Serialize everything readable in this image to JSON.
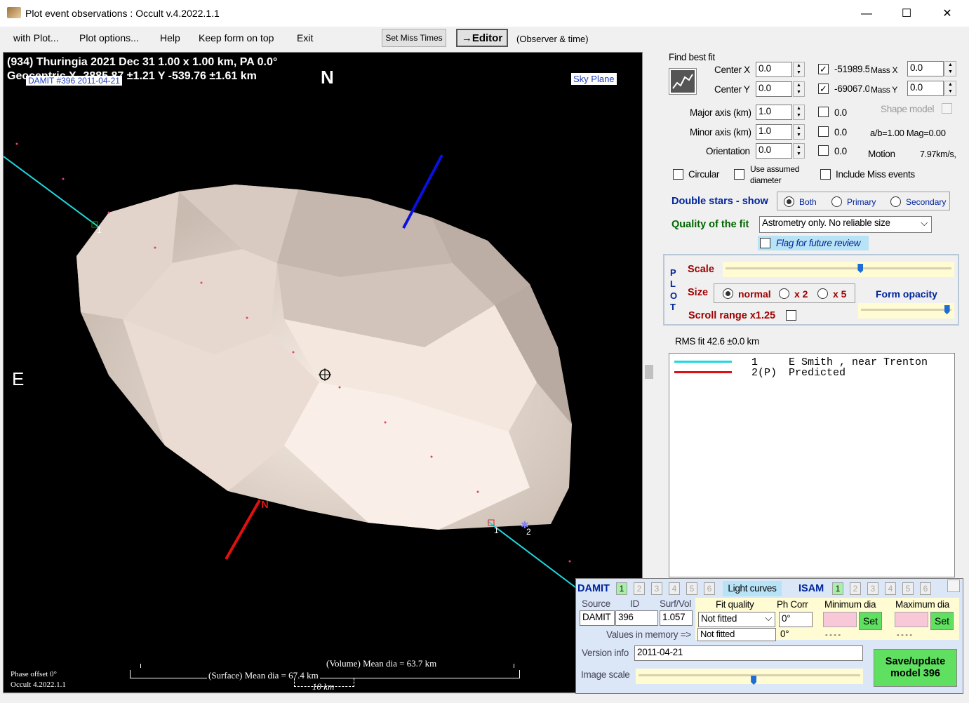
{
  "window": {
    "title": "Plot event observations : Occult v.4.2022.1.1",
    "minimize": "—",
    "maximize": "☐",
    "close": "✕"
  },
  "menu": {
    "items": [
      "with Plot...",
      "Plot options...",
      "Help",
      "Keep form on top",
      "Exit"
    ],
    "set_miss_times": "Set Miss Times",
    "editor": "→Editor",
    "observer_time": "(Observer & time)"
  },
  "plot": {
    "line1": "(934) Thuringia  2021 Dec 31   1.00 x 1.00 km, PA 0.0°",
    "line2": "Geocentric X -3885.87 ±1.21  Y -539.76 ±1.61 km",
    "damit_label": "DAMIT #396 2011-04-21",
    "north": "N",
    "east": "E",
    "sky_plane": "Sky Plane",
    "chord1_label": "1",
    "chord2_label": "1",
    "miss_label": "2",
    "north_pole": "N",
    "volume_dia": "(Volume) Mean dia = 63.7 km",
    "surface_dia": "(Surface) Mean dia = 67.4 km",
    "scale_km": "10 km",
    "phase_offset": "Phase offset 0°",
    "occult_version": "Occult 4.2022.1.1"
  },
  "fit": {
    "find_best_fit": "Find best fit",
    "center_x_label": "Center X",
    "center_x": "0.0",
    "center_y_label": "Center Y",
    "center_y": "0.0",
    "major_label": "Major axis (km)",
    "major": "1.0",
    "minor_label": "Minor axis (km)",
    "minor": "1.0",
    "orient_label": "Orientation",
    "orient": "0.0",
    "mass_x_val": "-51989.5",
    "mass_x_label": "Mass X",
    "mass_x": "0.0",
    "mass_y_val": "-69067.0",
    "mass_y_label": "Mass Y",
    "mass_y": "0.0",
    "chk_major": "0.0",
    "chk_minor": "0.0",
    "chk_orient": "0.0",
    "shape_model": "Shape model",
    "ab_mag": "a/b=1.00 Mag=0.00",
    "motion_label": "Motion",
    "motion_val": "7.97km/s,",
    "circular": "Circular",
    "use_assumed": "Use assumed",
    "diameter": "diameter",
    "include_miss": "Include Miss events",
    "double_stars": "Double stars - show",
    "both": "Both",
    "primary": "Primary",
    "secondary": "Secondary",
    "quality_label": "Quality of the fit",
    "quality_value": "Astrometry only. No reliable size",
    "flag_review": "Flag for future review"
  },
  "plotbox": {
    "p": "P",
    "l": "L",
    "o": "O",
    "t": "T",
    "scale": "Scale",
    "size": "Size",
    "normal": "normal",
    "x2": "x 2",
    "x5": "x 5",
    "form_opacity": "Form opacity",
    "scroll_range": "Scroll range x1.25",
    "scale_level": 0.6,
    "opacity_level": 0.98
  },
  "rms": "RMS fit 42.6 ±0.0 km",
  "legend": {
    "rows": [
      {
        "color": "#1ed8e0",
        "num": "1",
        "text": "E Smith , near Trenton"
      },
      {
        "color": "#e01010",
        "num": "2(P)",
        "text": "Predicted"
      }
    ]
  },
  "damit": {
    "damit_label": "DAMIT",
    "damit_nums": [
      "1",
      "2",
      "3",
      "4",
      "5",
      "6"
    ],
    "light_curves": "Light curves",
    "isam_label": "ISAM",
    "isam_nums": [
      "1",
      "2",
      "3",
      "4",
      "5",
      "6"
    ],
    "source_h": "Source",
    "id_h": "ID",
    "surfvol_h": "Surf/Vol",
    "fitq_h": "Fit quality",
    "phcorr_h": "Ph Corr",
    "mindia_h": "Minimum dia",
    "maxdia_h": "Maximum dia",
    "source": "DAMIT",
    "id": "396",
    "surfvol": "1.057",
    "fitq": "Not fitted",
    "phcorr": "0°",
    "values_mem": "Values in memory =>",
    "fitq_mem": "Not fitted",
    "phcorr_mem": "0°",
    "dashes": "- - - -",
    "set": "Set",
    "version_label": "Version info",
    "version": "2011-04-21",
    "image_scale": "Image scale",
    "image_scale_level": 0.52,
    "save": "Save/update",
    "model": "model 396"
  }
}
